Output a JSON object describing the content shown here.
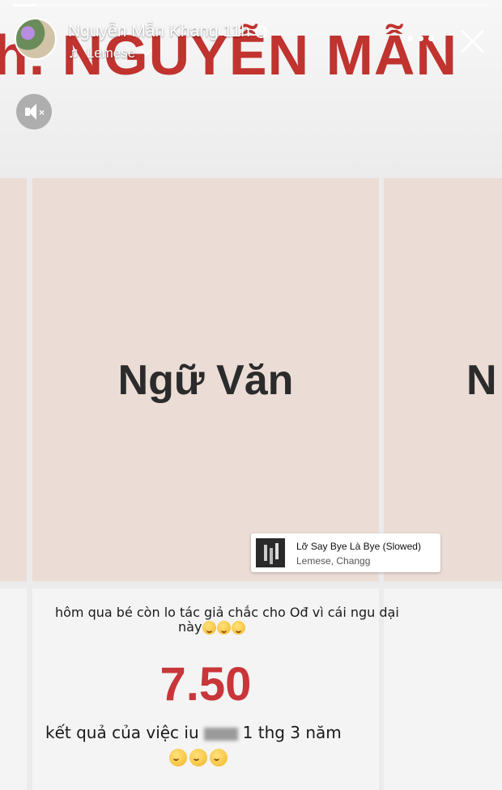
{
  "story": {
    "progress": 0.05,
    "username": "Nguyễn Mẫn Khang",
    "time": "11h",
    "music_artist": "Lemese"
  },
  "content": {
    "banner_text": "h. NGUYỄN MẪN",
    "subject": "Ngữ Văn",
    "subject_partial": "N",
    "caption_line1": "hôm qua bé còn lo tác giả chắc cho Ođ vì cái ngu dại",
    "caption_line1b": "này",
    "score": "7.50",
    "caption_line2_a": "kết quả của việc iu",
    "caption_line2_b": "1 thg 3 năm"
  },
  "music_sticker": {
    "title": "Lỡ Say Bye Là Bye (Slowed)",
    "artists": "Lemese, Changg"
  },
  "colors": {
    "banner_red": "#c0332f",
    "score_red": "#c8363a",
    "cell_pink": "#ebdcd6"
  },
  "icons": [
    "globe-icon",
    "music-note-icon",
    "chevron-down-icon",
    "more-icon",
    "close-icon",
    "mute-icon",
    "crying-emoji-icon"
  ]
}
